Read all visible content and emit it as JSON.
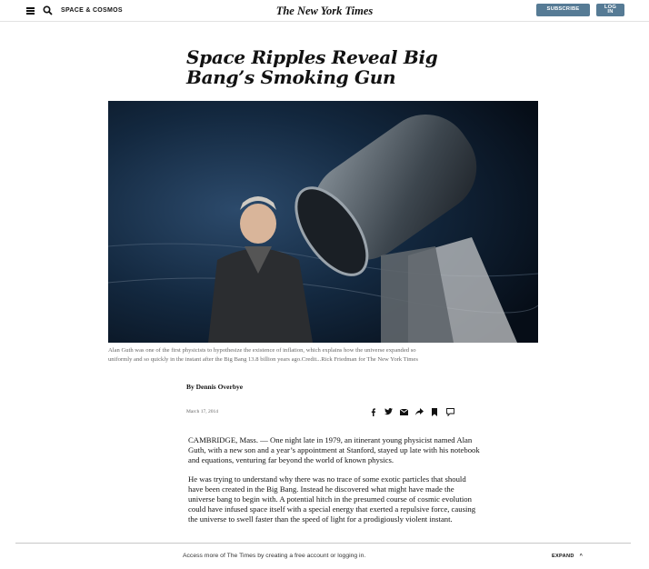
{
  "header": {
    "section": "Space & Cosmos",
    "logo": "The New York Times",
    "subscribe_label": "Subscribe",
    "login_label": "Log In",
    "accent_color": "#567b95"
  },
  "article": {
    "headline": "Space Ripples Reveal Big Bang’s Smoking Gun",
    "photo_alt": "Alan Guth beside a telescope at night",
    "caption": "Alan Guth was one of the first physicists to hypothesize the existence of inflation, which explains how the universe expanded so uniformly and so quickly in the instant after the Big Bang 13.8 billion years ago.Credit...Rick Friedman for The New York Times",
    "byline": "By Dennis Overbye",
    "date": "March 17, 2014",
    "share_icons": [
      "facebook-icon",
      "twitter-icon",
      "email-icon",
      "share-icon",
      "bookmark-icon",
      "comment-icon"
    ],
    "paragraphs": [
      "CAMBRIDGE, Mass. — One night late in 1979, an itinerant young physicist named Alan Guth, with a new son and a year’s appointment at Stanford, stayed up late with his notebook and equations, venturing far beyond the world of known physics.",
      "He was trying to understand why there was no trace of some exotic particles that should have been created in the Big Bang. Instead he discovered what might have made the universe bang to begin with. A potential hitch in the presumed course of cosmic evolution could have infused space itself with a special energy that exerted a repulsive force, causing the universe to swell faster than the speed of light for a prodigiously violent instant."
    ]
  },
  "footer": {
    "message": "Access more of The Times by creating a free account or logging in.",
    "expand_label": "EXPAND"
  }
}
